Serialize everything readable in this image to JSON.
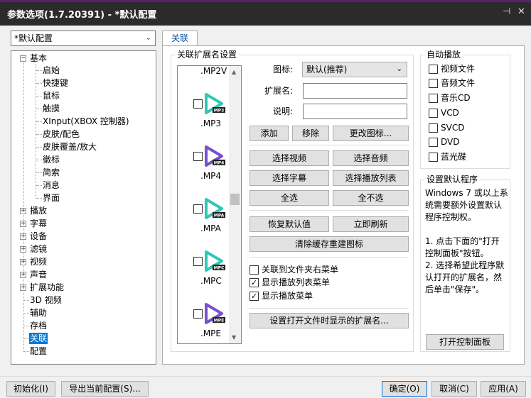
{
  "window": {
    "title": "参数选项(1.7.20391) - *默认配置",
    "pin_icon": "pin-icon",
    "close_icon": "close-icon"
  },
  "profile_select": {
    "value": "*默认配置"
  },
  "tree": {
    "basic": {
      "label": "基本",
      "children": [
        "启始",
        "快捷键",
        "鼠标",
        "触摸",
        "XInput(XBOX 控制器)",
        "皮肤/配色",
        "皮肤覆盖/放大",
        "徽标",
        "简索",
        "消息",
        "界面"
      ]
    },
    "nodes": [
      "播放",
      "字幕",
      "设备",
      "滤镜",
      "视频",
      "声音",
      "扩展功能"
    ],
    "leaves": [
      "3D 视频",
      "辅助",
      "存档"
    ],
    "selected": "关联",
    "last": "配置"
  },
  "tab": {
    "label": "关联"
  },
  "ext_group": {
    "title": "关联扩展名设置",
    "list": [
      {
        "name": ".MP2V",
        "badge": "",
        "color": ""
      },
      {
        "name": ".MP3",
        "badge": "MP3",
        "color": "#2fc9b5"
      },
      {
        "name": ".MP4",
        "badge": "MP4",
        "color": "#7a4fd0"
      },
      {
        "name": ".MPA",
        "badge": "MPA",
        "color": "#2fc9b5"
      },
      {
        "name": ".MPC",
        "badge": "MPC",
        "color": "#2fc9b5"
      },
      {
        "name": ".MPE",
        "badge": "MPE",
        "color": "#7a4fd0"
      }
    ],
    "icon_label": "图标:",
    "icon_value": "默认(推荐)",
    "ext_label": "扩展名:",
    "desc_label": "说明:",
    "add_button": "添加",
    "remove_button": "移除",
    "change_icon_button": "更改图标...",
    "select_video": "选择视频",
    "select_audio": "选择音频",
    "select_subtitle": "选择字幕",
    "select_playlist": "选择播放列表",
    "select_all": "全选",
    "select_none": "全不选",
    "restore_default": "恢复默认值",
    "refresh_now": "立即刷新",
    "clear_cache": "清除缓存重建图标",
    "cb_folder_menu": "关联到文件夹右菜单",
    "cb_playlist_menu": "显示播放列表菜单",
    "cb_play_menu": "显示播放菜单",
    "cb_folder_checked": false,
    "cb_playlist_checked": true,
    "cb_play_checked": true,
    "open_ext_button": "设置打开文件时显示的扩展名..."
  },
  "autoplay": {
    "title": "自动播放",
    "items": [
      "视频文件",
      "音频文件",
      "音乐CD",
      "VCD",
      "SVCD",
      "DVD",
      "蓝光碟"
    ]
  },
  "default_program": {
    "title": "设置默认程序",
    "line1": "Windows 7 或以上系",
    "line2": "统需要额外设置默认",
    "line3": "程序控制权。",
    "line4": "1. 点击下面的\"打开",
    "line5": "控制面板\"按钮。",
    "line6": "2. 选择希望此程序默",
    "line7": "认打开的扩展名，然",
    "line8": "后单击\"保存\"。",
    "button": "打开控制面板"
  },
  "footer": {
    "init_button": "初始化(I)",
    "export_button": "导出当前配置(S)...",
    "ok_button": "确定(O)",
    "cancel_button": "取消(C)",
    "apply_button": "应用(A)"
  }
}
